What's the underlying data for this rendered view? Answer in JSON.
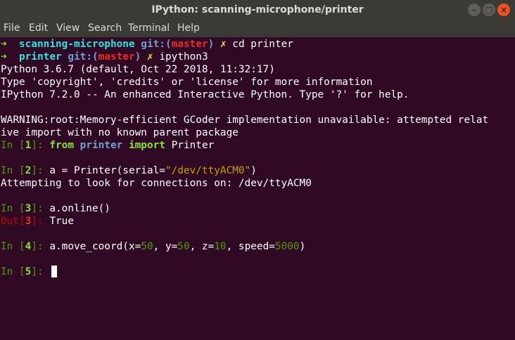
{
  "window": {
    "title": "IPython: scanning-microphone/printer",
    "buttons": {
      "minimize": "–",
      "maximize": "□",
      "close": "×"
    }
  },
  "menu": [
    "File",
    "Edit",
    "View",
    "Search",
    "Terminal",
    "Help"
  ],
  "prompt": {
    "arrow": "➜",
    "git": "git:(",
    "branch": "master",
    "git_close": ")",
    "dirty": "✗"
  },
  "shell": [
    {
      "dir": "scanning-microphone",
      "command": "cd printer"
    },
    {
      "dir": "printer",
      "command": "ipython3"
    }
  ],
  "banner": [
    "Python 3.6.7 (default, Oct 22 2018, 11:32:17)",
    "Type 'copyright', 'credits' or 'license' for more information",
    "IPython 7.2.0 -- An enhanced Interactive Python. Type '?' for help."
  ],
  "warning": [
    "WARNING:root:Memory-efficient GCoder implementation unavailable: attempted relat",
    "ive import with no known parent package"
  ],
  "ipython": {
    "in_label": "In [",
    "out_label": "Out[",
    "close_label": "]: ",
    "cells": [
      {
        "n": "1",
        "kw_from": "from",
        "module": "printer",
        "kw_import": "import",
        "name": "Printer"
      },
      {
        "n": "2",
        "code_a": "a = Printer(serial=",
        "string": "\"/dev/ttyACM0\"",
        "code_b": ")",
        "output": "Attempting to look for connections on: /dev/ttyACM0"
      },
      {
        "n": "3",
        "code": "a.online()",
        "out": "True"
      },
      {
        "n": "4",
        "p1": "a.move_coord(x=",
        "x": "50",
        "p2": ", y=",
        "y": "50",
        "p3": ", z=",
        "z": "10",
        "p4": ", speed=",
        "speed": "5000",
        "p5": ")"
      },
      {
        "n": "5"
      }
    ]
  }
}
